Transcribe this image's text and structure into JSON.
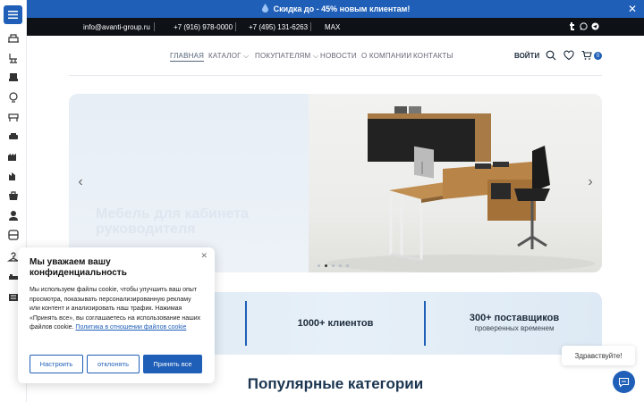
{
  "promo": {
    "text": "Скидка до - 45% новым клиентам!"
  },
  "contacts": {
    "email": "info@avanti-group.ru",
    "phone1": "+7 (916) 978-0000",
    "phone2": "+7 (495) 131-6263",
    "max": "MAX"
  },
  "nav": {
    "items": [
      {
        "label": "ГЛАВНАЯ"
      },
      {
        "label": "КАТАЛОГ"
      },
      {
        "label": "ПОКУПАТЕЛЯМ"
      },
      {
        "label": "НОВОСТИ"
      },
      {
        "label": "О КОМПАНИИ"
      },
      {
        "label": "КОНТАКТЫ"
      }
    ],
    "login": "ВОЙТИ",
    "cart_count": "0"
  },
  "hero": {
    "ghost_text": "Мебель для кабинета руководителя"
  },
  "stats": [
    {
      "number": "1000+ клиентов",
      "sub": ""
    },
    {
      "number": "300+ поставщиков",
      "sub": "проверенных временем"
    }
  ],
  "section": {
    "title": "Популярные категории"
  },
  "cookie": {
    "title": "Мы уважаем вашу конфиденциальность",
    "body": "Мы используем файлы cookie, чтобы улучшить ваш опыт просмотра, показывать персонализированную рекламу или контент и анализировать наш трафик. Нажимая «Принять все», вы соглашаетесь на использование наших файлов cookie.",
    "policy_link": "Политика в отношении файлов cookie",
    "btn_settings": "Настроить",
    "btn_decline": "отклонять",
    "btn_accept": "Принять все"
  },
  "chat": {
    "greeting": "Здравствуйте!"
  },
  "colors": {
    "brand": "#1f5fb8",
    "dark_bar": "#0e1116"
  }
}
